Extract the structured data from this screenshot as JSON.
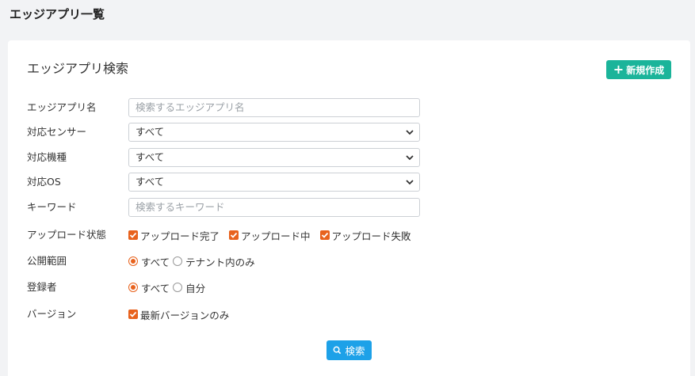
{
  "page": {
    "title": "エッジアプリ一覧"
  },
  "card": {
    "title": "エッジアプリ検索",
    "new_button": "新規作成"
  },
  "form": {
    "app_name": {
      "label": "エッジアプリ名",
      "placeholder": "検索するエッジアプリ名"
    },
    "sensor": {
      "label": "対応センサー",
      "value": "すべて"
    },
    "model": {
      "label": "対応機種",
      "value": "すべて"
    },
    "os": {
      "label": "対応OS",
      "value": "すべて"
    },
    "keyword": {
      "label": "キーワード",
      "placeholder": "検索するキーワード"
    },
    "upload_status": {
      "label": "アップロード状態",
      "options": [
        {
          "label": "アップロード完了",
          "checked": true
        },
        {
          "label": "アップロード中",
          "checked": true
        },
        {
          "label": "アップロード失敗",
          "checked": true
        }
      ]
    },
    "scope": {
      "label": "公開範囲",
      "options": [
        {
          "label": "すべて",
          "selected": true
        },
        {
          "label": "テナント内のみ",
          "selected": false
        }
      ]
    },
    "registrant": {
      "label": "登録者",
      "options": [
        {
          "label": "すべて",
          "selected": true
        },
        {
          "label": "自分",
          "selected": false
        }
      ]
    },
    "version": {
      "label": "バージョン",
      "options": [
        {
          "label": "最新バージョンのみ",
          "checked": true
        }
      ]
    },
    "search_button": "検索"
  },
  "colors": {
    "accent_orange": "#e8621d",
    "new_button": "#1bb49a",
    "search_button": "#1da1e8"
  }
}
